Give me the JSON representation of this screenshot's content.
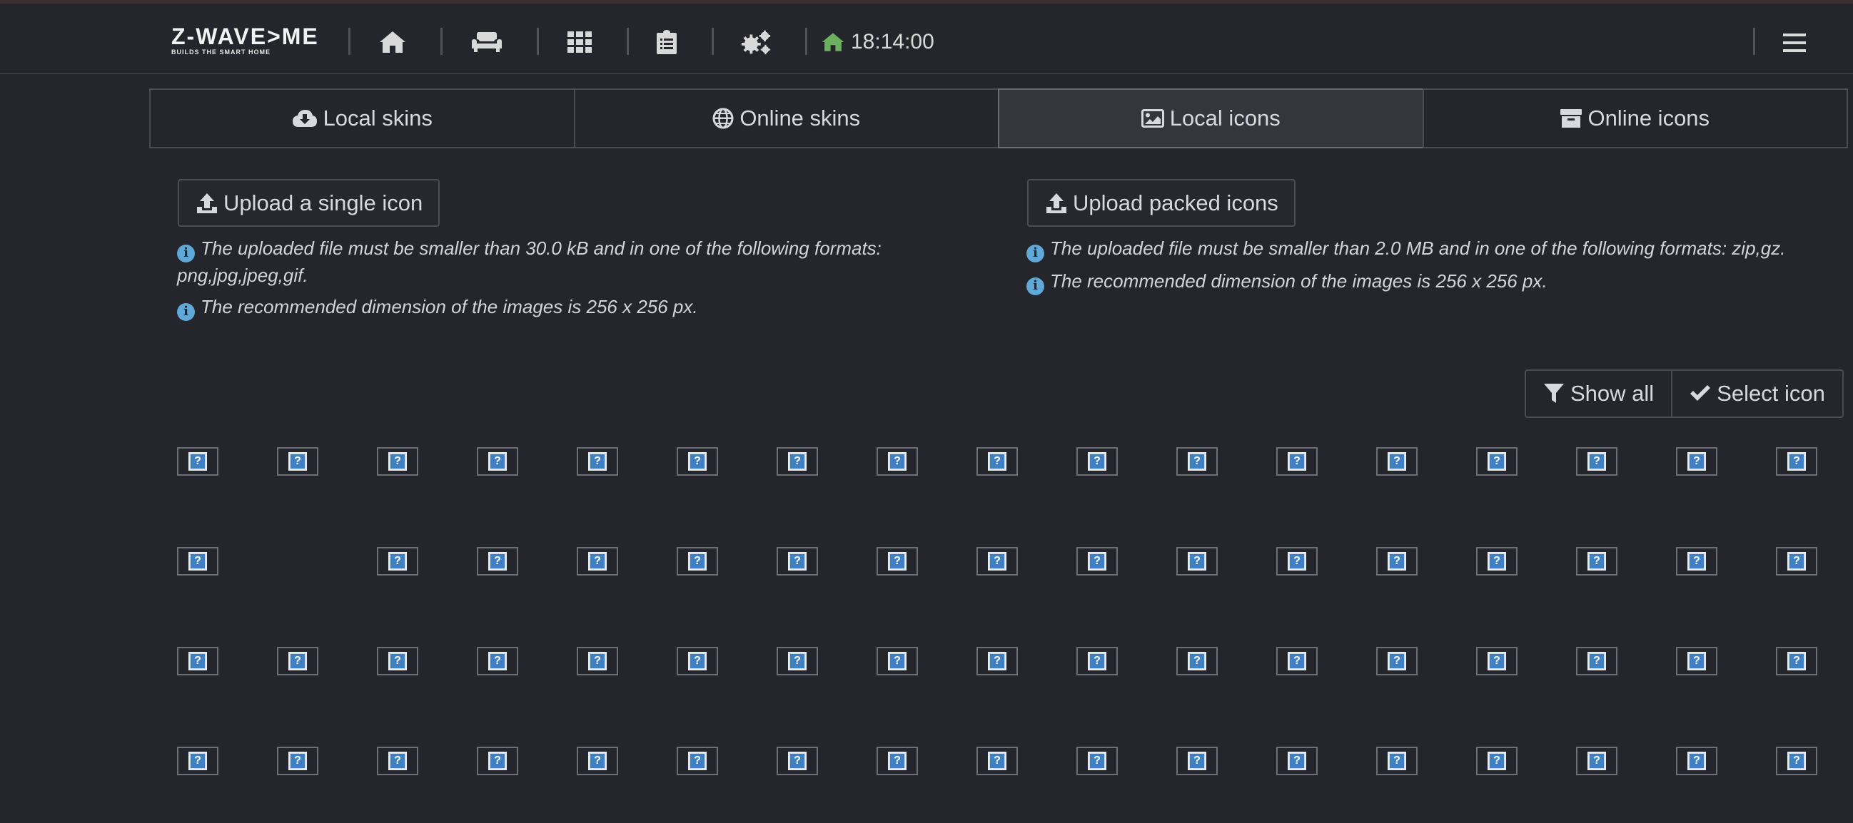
{
  "header": {
    "logo_text": "Z-WAVE>ME",
    "logo_tagline": "BUILDS THE SMART HOME",
    "nav_icons": [
      "home-icon",
      "sofa-icon",
      "grid-icon",
      "clipboard-icon",
      "gears-icon"
    ],
    "clock": "18:14:00",
    "clock_icon": "home-icon",
    "clock_icon_color": "#6cb05f",
    "menu_icon": "hamburger-menu-icon"
  },
  "tabs": [
    {
      "label": "Local skins",
      "icon": "cloud-download-icon",
      "active": false
    },
    {
      "label": "Online skins",
      "icon": "globe-icon",
      "active": false
    },
    {
      "label": "Local icons",
      "icon": "image-icon",
      "active": true
    },
    {
      "label": "Online icons",
      "icon": "archive-icon",
      "active": false
    }
  ],
  "upload_single": {
    "label": "Upload a single icon",
    "info_1": "The uploaded file must be smaller than 30.0 kB and in one of the following formats:",
    "info_1b": "png,jpg,jpeg,gif.",
    "info_2": "The recommended dimension of the images is 256 x 256 px."
  },
  "upload_packed": {
    "label": "Upload packed icons",
    "info_1": "The uploaded file must be smaller than 2.0 MB and in one of the following formats: zip,gz.",
    "info_2": "The recommended dimension of the images is 256 x 256 px."
  },
  "toolbar": {
    "show_all": "Show all",
    "select_icon": "Select icon"
  },
  "icon_grid": {
    "rows": 4,
    "columns": 17,
    "missing": [
      [
        1,
        1
      ]
    ],
    "placeholder_glyph": "?",
    "colors": {
      "accent": "#3f7fc4",
      "info": "#5fa8d8"
    }
  }
}
